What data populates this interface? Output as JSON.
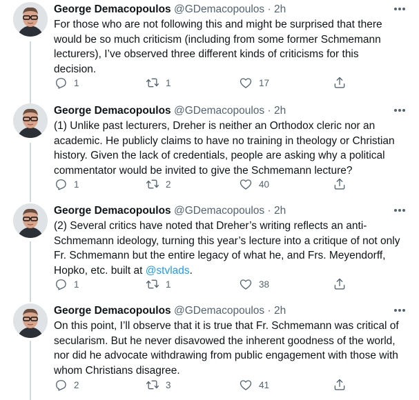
{
  "tweets": [
    {
      "name": "George Demacopoulos",
      "handle": "@GDemacopoulos",
      "sep": "·",
      "time": "2h",
      "lines": [
        "For those who are not following this and might be surprised that there",
        "would be so much criticism (including from some former Schmemann",
        "lecturers), I’ve observed three different kinds of criticisms for this",
        "decision."
      ],
      "replies": "1",
      "retweets": "1",
      "likes": "17"
    },
    {
      "name": "George Demacopoulos",
      "handle": "@GDemacopoulos",
      "sep": "·",
      "time": "2h",
      "lines": [
        "(1) Unlike past lecturers, Dreher is neither an Orthodox cleric nor an",
        "academic.  He publicly claims to have no training in theology or Christian",
        "history.  Given the lack of credentials, people are asking why a political",
        "commentator would be invited to give the Schmemann lecture?"
      ],
      "replies": "1",
      "retweets": "2",
      "likes": "40"
    },
    {
      "name": "George Demacopoulos",
      "handle": "@GDemacopoulos",
      "sep": "·",
      "time": "2h",
      "lines": [
        "(2) Several critics have noted that Dreher’s writing reflects an anti-",
        "Schmemann ideology, turning this year’s lecture into a critique of not only",
        "Fr. Schmemann but the entire legacy of what he, and Frs. Meyendorff,"
      ],
      "last_line_prefix": "Hopko, etc. built at ",
      "mention": "@stvlads",
      "last_line_suffix": ".",
      "replies": "1",
      "retweets": "1",
      "likes": "38"
    },
    {
      "name": "George Demacopoulos",
      "handle": "@GDemacopoulos",
      "sep": "·",
      "time": "2h",
      "lines": [
        "On this point, I’ll observe that it is true that Fr. Schmemann was critical of",
        "secularism.  But he never disavowed the inherent goodness of the world,",
        "nor did he advocate withdrawing from public engagement with those with",
        "whom Christians disagree."
      ],
      "replies": "2",
      "retweets": "3",
      "likes": "41"
    }
  ],
  "icons": {
    "reply": "reply-icon",
    "retweet": "retweet-icon",
    "like": "heart-icon",
    "share": "share-icon",
    "more": "more-icon"
  },
  "colors": {
    "text": "#0f1419",
    "secondary": "#536471",
    "link": "#1d9bf0",
    "thread_line": "#cfd9de"
  }
}
